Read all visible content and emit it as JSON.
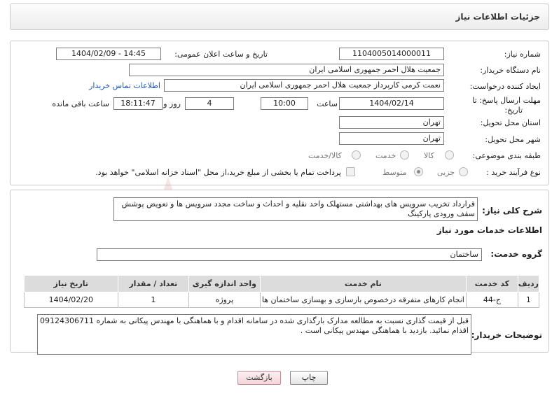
{
  "header": {
    "title": "جزئیات اطلاعات نیاز"
  },
  "fields": {
    "need_number_label": "شماره نیاز:",
    "need_number": "1104005014000011",
    "announce_label": "تاریخ و ساعت اعلان عمومی:",
    "announce_value": "1404/02/09 - 14:45",
    "buyer_org_label": "نام دستگاه خریدار:",
    "buyer_org": "جمعیت هلال احمر جمهوری اسلامی ایران",
    "creator_label": "ایجاد کننده درخواست:",
    "creator": "نعمت کرمی کارپرداز جمعیت هلال احمر جمهوری اسلامی ایران",
    "contact_link": "اطلاعات تماس خریدار",
    "deadline_label_1": "مهلت ارسال پاسخ: تا",
    "deadline_label_2": "تاریخ:",
    "deadline_date": "1404/02/14",
    "time_label": "ساعت",
    "deadline_time": "10:00",
    "days_value": "4",
    "days_label": "روز و",
    "remaining_time": "18:11:47",
    "remaining_label": "ساعت باقی مانده",
    "province_label": "استان محل تحویل:",
    "province": "تهران",
    "city_label": "شهر محل تحویل:",
    "city": "تهران",
    "category_label": "طبقه بندی موضوعی:",
    "category_options": [
      "کالا",
      "خدمت",
      "کالا/خدمت"
    ],
    "process_label": "نوع فرآیند خرید :",
    "process_options": [
      "جزیی",
      "متوسط"
    ],
    "payment_note": "پرداخت تمام یا بخشی از مبلغ خرید،از محل \"اسناد خزانه اسلامی\" خواهد بود."
  },
  "summary": {
    "label": "شرح کلی نیاز:",
    "text": "قرارداد تخریب سرویس های بهداشتی مستهلک واحد نقلیه و احداث و ساخت مجدد سرویس ها و تعویض پوشش سقف ورودی پارکینگ"
  },
  "services": {
    "section_title": "اطلاعات خدمات مورد نیاز",
    "group_label": "گروه خدمت:",
    "group_value": "ساختمان",
    "columns": [
      "ردیف",
      "کد خدمت",
      "نام خدمت",
      "واحد اندازه گیری",
      "تعداد / مقدار",
      "تاریخ نیاز"
    ],
    "rows": [
      [
        "1",
        "ج-44",
        "انجام کارهای متفرقه درخصوص بازسازی و بهسازی ساختمان ها",
        "پروژه",
        "1",
        "1404/02/20"
      ]
    ]
  },
  "buyer_notes": {
    "label": "توضیحات خریدار:",
    "text": "قبل از قیمت گذاری نسبت به مطالعه مدارک بارگذاری شده در سامانه اقدام و با هماهنگی با مهندس پیکانی به شماره 09124306711 اقدام نمائید. بازدید با هماهنگی مهندس پیکانی است ."
  },
  "buttons": {
    "print": "چاپ",
    "back": "بازگشت"
  },
  "watermark": {
    "text": "AriaTender.net"
  },
  "colors": {
    "link": "#1a56b8",
    "header_bg": "#ececec",
    "table_header": "#dcdcdc",
    "back_button": "#f3d4da"
  }
}
